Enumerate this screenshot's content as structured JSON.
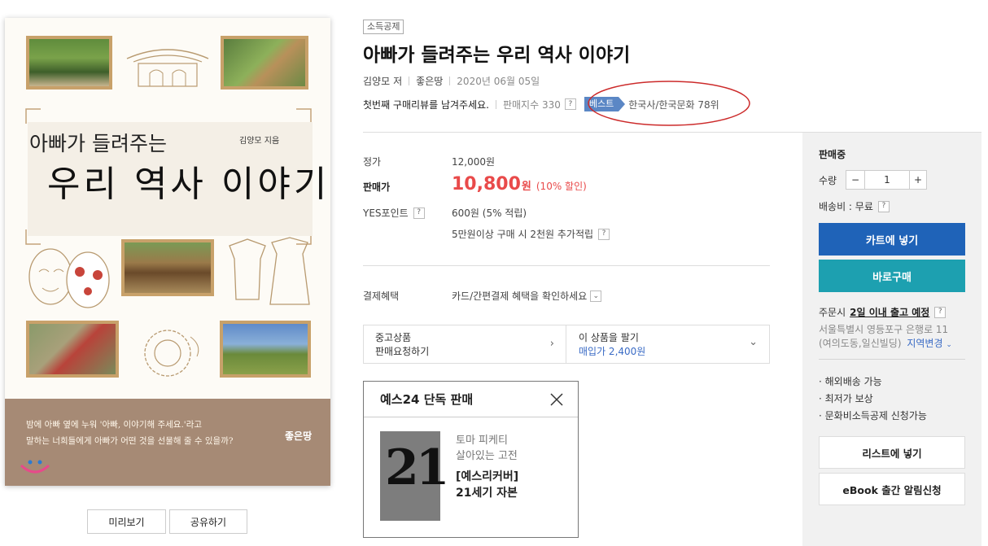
{
  "cover": {
    "title_small": "아빠가 들려주는",
    "title_big": "우리 역사 이야기",
    "author": "김양모 지음",
    "band_line1": "밤에 아빠 옆에 누워 '아빠, 이야기해 주세요.'라고",
    "band_line2": "말하는 너희들에게 아빠가 어떤 것을 선물해 줄 수 있을까?",
    "publisher_logo": "좋은땅",
    "preview_btn": "미리보기",
    "share_btn": "공유하기"
  },
  "product": {
    "badge": "소득공제",
    "title": "아빠가 들려주는 우리 역사 이야기",
    "author": "김양모",
    "author_suffix": "저",
    "publisher": "좋은땅",
    "date": "2020년 06월 05일",
    "review_prompt": "첫번째 구매리뷰를 남겨주세요.",
    "sales_index": "판매지수 330",
    "best_label": "베스트",
    "best_rank": "한국사/한국문화 78위"
  },
  "pricing": {
    "list_label": "정가",
    "list_price": "12,000원",
    "sale_label": "판매가",
    "sale_price": "10,800",
    "sale_won": "원",
    "discount": "(10% 할인)",
    "points_label": "YES포인트",
    "points_value": "600원 (5% 적립)",
    "extra_points": "5만원이상 구매 시 2천원 추가적립",
    "payment_label": "결제혜택",
    "payment_value": "카드/간편결제 혜택을 확인하세요"
  },
  "used": {
    "left_line1": "중고상품",
    "left_line2": "판매요청하기",
    "right_line1": "이 상품을 팔기",
    "right_line2": "매입가 2,400원"
  },
  "exclusive": {
    "header": "예스24 단독 판매",
    "sub1": "토마 피케티",
    "sub2": "살아있는 고전",
    "title1": "[예스리커버]",
    "title2": "21세기 자본",
    "cover_number": "21"
  },
  "panel": {
    "status": "판매중",
    "qty_label": "수량",
    "qty_value": "1",
    "minus": "−",
    "plus": "+",
    "shipping_label": "배송비 : 무료",
    "cart_btn": "카트에 넣기",
    "buy_btn": "바로구매",
    "order_prefix": "주문시",
    "order_bold": "2일 이내 출고 예정",
    "address1": "서울특별시 영등포구 은행로 11",
    "address2": "(여의도동,일신빌딩)",
    "region_change": "지역변경",
    "features": [
      "해외배송 가능",
      "최저가 보상",
      "문화비소득공제 신청가능"
    ],
    "list_btn": "리스트에 넣기",
    "ebook_btn": "eBook 출간 알림신청",
    "cart_color": "#1f63b8",
    "buy_color": "#1da0b0"
  }
}
